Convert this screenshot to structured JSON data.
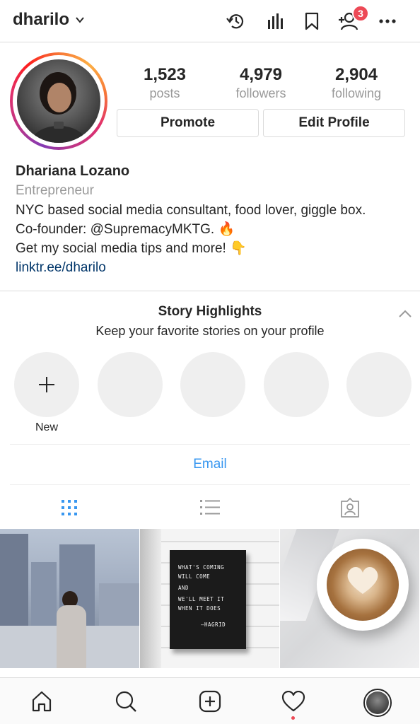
{
  "header": {
    "username": "dharilo",
    "notification_count": "3",
    "icons": [
      "archive-history-icon",
      "insights-icon",
      "saved-bookmark-icon",
      "discover-people-icon",
      "more-options-icon"
    ]
  },
  "profile": {
    "stats": [
      {
        "value": "1,523",
        "label": "posts"
      },
      {
        "value": "4,979",
        "label": "followers"
      },
      {
        "value": "2,904",
        "label": "following"
      }
    ],
    "buttons": {
      "promote": "Promote",
      "edit": "Edit Profile"
    },
    "name": "Dhariana Lozano",
    "category": "Entrepreneur",
    "bio_lines": [
      "NYC based social media consultant, food lover, giggle box.",
      "Co-founder: @SupremacyMKTG. 🔥",
      "Get my social media tips and more! 👇"
    ],
    "link": "linktr.ee/dharilo"
  },
  "highlights": {
    "title": "Story Highlights",
    "subtitle": "Keep your favorite stories on your profile",
    "new_label": "New"
  },
  "contact": {
    "email": "Email"
  },
  "tabs": [
    "grid-view-icon",
    "list-view-icon",
    "tagged-photos-icon"
  ],
  "posts": {
    "letterboard_lines": [
      "WHAT'S COMING",
      "WILL COME",
      "AND",
      "WE'LL MEET IT",
      "WHEN IT DOES",
      "—HAGRID"
    ]
  },
  "bottom_nav": [
    "home-icon",
    "search-icon",
    "new-post-icon",
    "activity-heart-icon",
    "profile-avatar"
  ],
  "colors": {
    "accent": "#3897f0",
    "badge": "#ed4956",
    "link": "#003569"
  }
}
